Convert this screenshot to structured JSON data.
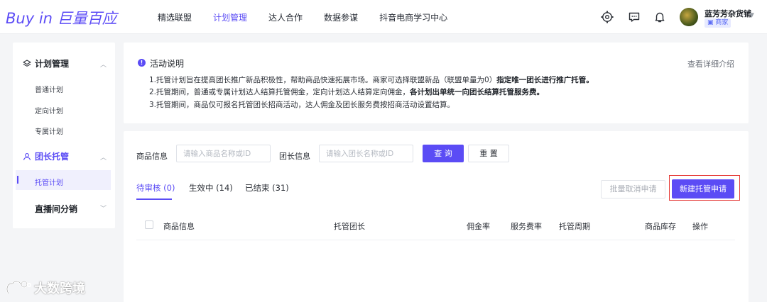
{
  "header": {
    "logo_text": "Buy in 巨量百应",
    "nav": [
      {
        "label": "精选联盟",
        "active": false
      },
      {
        "label": "计划管理",
        "active": true
      },
      {
        "label": "达人合作",
        "active": false
      },
      {
        "label": "数据参谋",
        "active": false
      },
      {
        "label": "抖音电商学习中心",
        "active": false
      }
    ],
    "icons": [
      "gear-icon",
      "message-icon",
      "bell-icon"
    ],
    "user": {
      "name": "蓝芳芳杂货铺",
      "role_badge": "商家"
    }
  },
  "sidebar": {
    "groups": [
      {
        "label": "计划管理",
        "icon": "layers-icon",
        "items": [
          "普通计划",
          "定向计划",
          "专属计划"
        ]
      },
      {
        "label": "团长托管",
        "icon": "team-icon",
        "active": true,
        "items": [
          "托管计划"
        ]
      },
      {
        "label": "直播间分销",
        "items": []
      }
    ]
  },
  "notice": {
    "title": "活动说明",
    "link": "查看详细介绍",
    "line1_prefix": "1.托管计划旨在提高团长推广新品积极性，帮助商品快速拓展市场。商家可选择联盟新品（联盟单量为0）",
    "line1_bold": "指定唯一团长进行推广托管。",
    "line2_prefix": "2.托管期间，普通或专属计划达人结算托管佣金，定向计划达人结算定向佣金，",
    "line2_bold": "各计划出单统一向团长结算托管服务费。",
    "line3": "3.托管期间，商品仅可报名托管团长招商活动，达人佣金及团长服务费按招商活动设置结算。"
  },
  "filters": {
    "product_label": "商品信息",
    "product_placeholder": "请输入商品名称或ID",
    "leader_label": "团长信息",
    "leader_placeholder": "请输入团长名称或ID",
    "query_button": "查 询",
    "reset_button": "重 置"
  },
  "tabs": [
    {
      "label": "待审核 (0)",
      "active": true
    },
    {
      "label": "生效中 (14)",
      "active": false
    },
    {
      "label": "已结束 (31)",
      "active": false
    }
  ],
  "actions": {
    "batch_cancel": "批量取消申请",
    "new_request": "新建托管申请"
  },
  "table": {
    "columns": [
      "商品信息",
      "托管团长",
      "佣金率",
      "服务费率",
      "托管周期",
      "商品库存",
      "操作"
    ]
  },
  "watermark": "大数跨境",
  "colors": {
    "accent": "#5b4cf5",
    "highlight": "#e53935"
  }
}
